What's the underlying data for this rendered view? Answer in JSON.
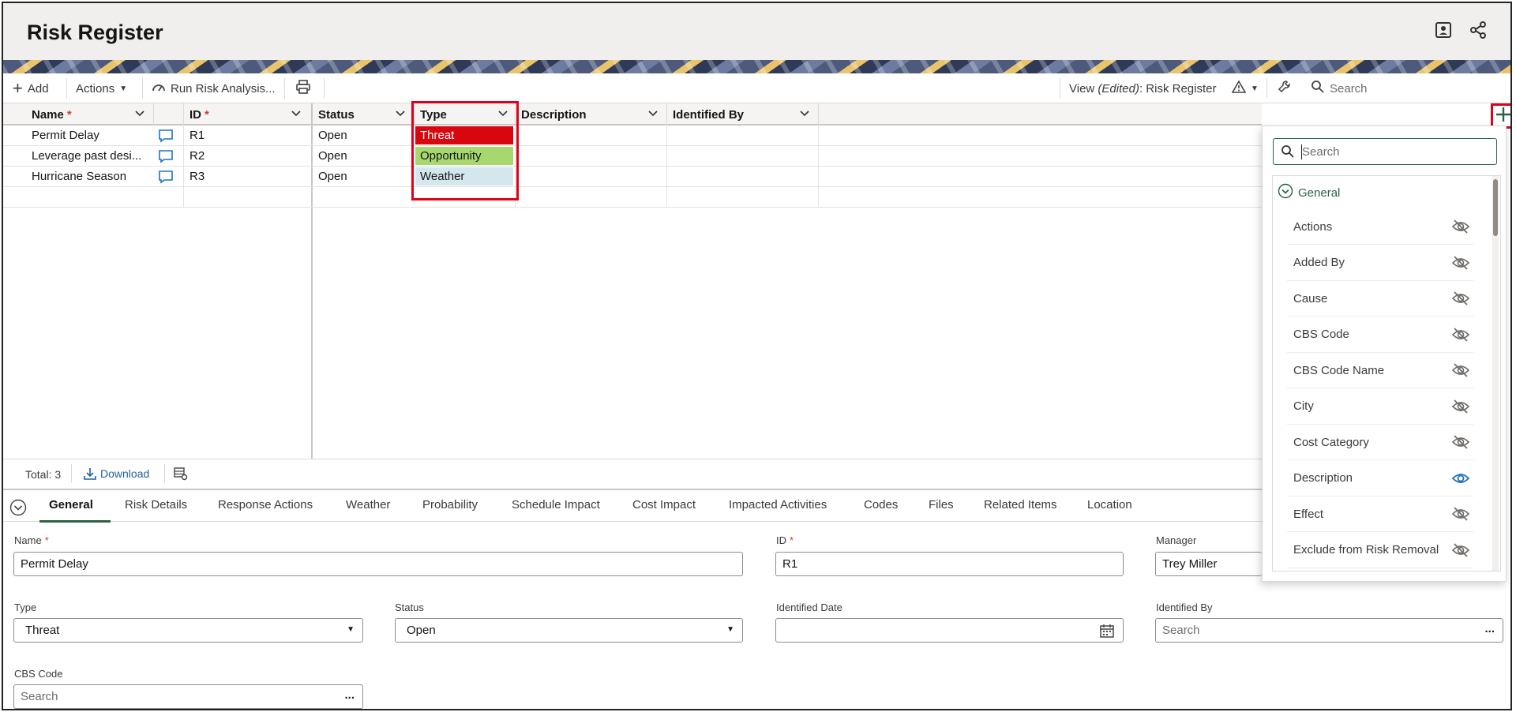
{
  "header": {
    "title": "Risk Register",
    "icons": [
      "profile-card-icon",
      "share-icon"
    ]
  },
  "toolbar": {
    "add_label": "Add",
    "actions_label": "Actions",
    "run_label": "Run Risk Analysis...",
    "view_prefix": "View ",
    "view_edited": "(Edited)",
    "view_name": ": Risk Register",
    "search_placeholder": "Search"
  },
  "grid": {
    "columns": [
      "Name",
      "ID",
      "Status",
      "Type",
      "Description",
      "Identified By"
    ],
    "rows": [
      {
        "name": "Permit Delay",
        "id": "R1",
        "status": "Open",
        "type": "Threat"
      },
      {
        "name": "Leverage past desi...",
        "id": "R2",
        "status": "Open",
        "type": "Opportunity"
      },
      {
        "name": "Hurricane Season",
        "id": "R3",
        "status": "Open",
        "type": "Weather"
      }
    ],
    "type_colors": {
      "Threat": "#d8070f",
      "Opportunity": "#a6d86f",
      "Weather": "#d4e7ef"
    },
    "total": "Total: 3",
    "download_label": "Download"
  },
  "tabs": [
    "General",
    "Risk Details",
    "Response Actions",
    "Weather",
    "Probability",
    "Schedule Impact",
    "Cost Impact",
    "Impacted Activities",
    "Codes",
    "Files",
    "Related Items",
    "Location"
  ],
  "form": {
    "name_label": "Name",
    "name_value": "Permit Delay",
    "id_label": "ID",
    "id_value": "R1",
    "manager_label": "Manager",
    "manager_value": "Trey Miller",
    "type_label": "Type",
    "type_value": "Threat",
    "status_label": "Status",
    "status_value": "Open",
    "identified_date_label": "Identified Date",
    "identified_date_value": "",
    "identified_by_label": "Identified By",
    "identified_by_placeholder": "Search",
    "cbs_label": "CBS Code",
    "cbs_placeholder": "Search",
    "required_mark": "*"
  },
  "column_panel": {
    "search_placeholder": "Search",
    "group": "General",
    "items": [
      {
        "label": "Actions",
        "visible": false
      },
      {
        "label": "Added By",
        "visible": false
      },
      {
        "label": "Cause",
        "visible": false
      },
      {
        "label": "CBS Code",
        "visible": false
      },
      {
        "label": "CBS Code Name",
        "visible": false
      },
      {
        "label": "City",
        "visible": false
      },
      {
        "label": "Cost Category",
        "visible": false
      },
      {
        "label": "Description",
        "visible": true
      },
      {
        "label": "Effect",
        "visible": false
      },
      {
        "label": "Exclude from Risk Removal",
        "visible": false
      }
    ]
  },
  "colors": {
    "accent": "#2b6242",
    "highlight": "#e0001b",
    "required": "#c74634"
  }
}
